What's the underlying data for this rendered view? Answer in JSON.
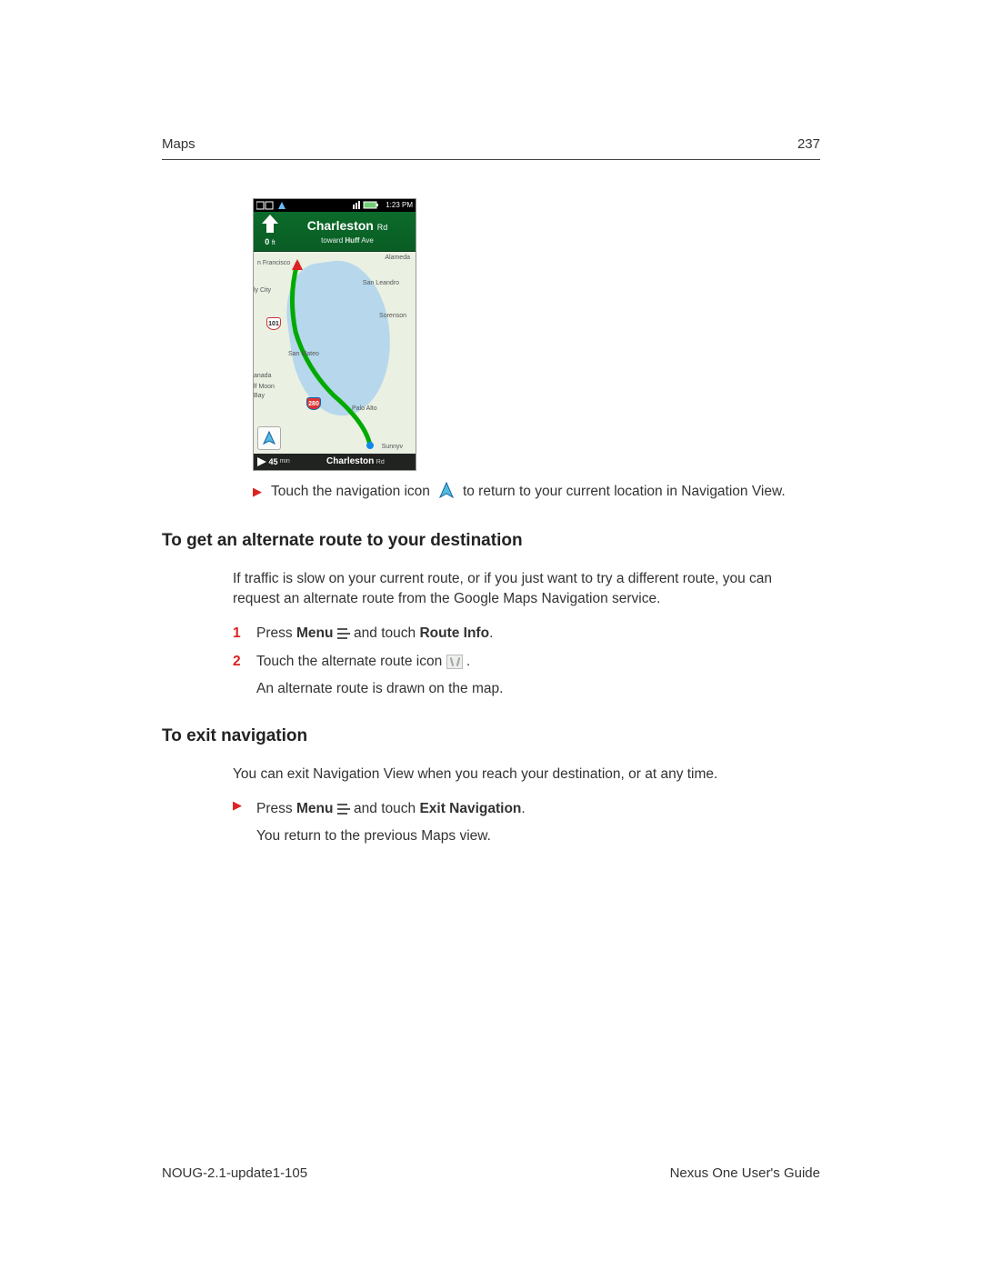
{
  "header": {
    "section": "Maps",
    "page": "237"
  },
  "screenshot": {
    "statusbar": {
      "time": "1:23 PM"
    },
    "nav": {
      "distance_value": "0",
      "distance_unit": "ft",
      "street_main": "Charleston",
      "street_suffix": "Rd",
      "toward_prefix": "toward",
      "toward_main": "Huff",
      "toward_suffix": "Ave"
    },
    "labels": {
      "sf": "n Francisco",
      "alameda": "Alameda",
      "sanleandro": "San Leandro",
      "dalycity": "ly City",
      "sorenson": "Sorenson",
      "sanmateo": "San Mateo",
      "canada": "anada",
      "halfmoon": "lf Moon\nBay",
      "paloalto": "Palo Alto",
      "sunny": "Sunnyv"
    },
    "shields": {
      "us101": "101",
      "i280": "280"
    },
    "eta": {
      "value": "45",
      "unit": "min",
      "dest_main": "Charleston",
      "dest_suffix": "Rd"
    }
  },
  "tip": {
    "pre": "Touch the navigation icon",
    "post": "to return to your current location in Navigation View."
  },
  "sectionA": {
    "title": "To get an alternate route to your destination",
    "intro": "If traffic is slow on your current route, or if you just want to try a different route, you can request an alternate route from the Google Maps Navigation service.",
    "step1_pre": "Press",
    "step1_menu": "Menu",
    "step1_mid": "and touch",
    "step1_target": "Route Info",
    "step1_post": ".",
    "step2_pre": "Touch the alternate route icon",
    "step2_post": ".",
    "step2_result": "An alternate route is drawn on the map."
  },
  "sectionB": {
    "title": "To exit navigation",
    "intro": "You can exit Navigation View when you reach your destination, or at any time.",
    "step_pre": "Press",
    "step_menu": "Menu",
    "step_mid": "and touch",
    "step_target": "Exit Navigation",
    "step_post": ".",
    "result": "You return to the previous Maps view."
  },
  "footer": {
    "left": "NOUG-2.1-update1-105",
    "right": "Nexus One User's Guide"
  }
}
